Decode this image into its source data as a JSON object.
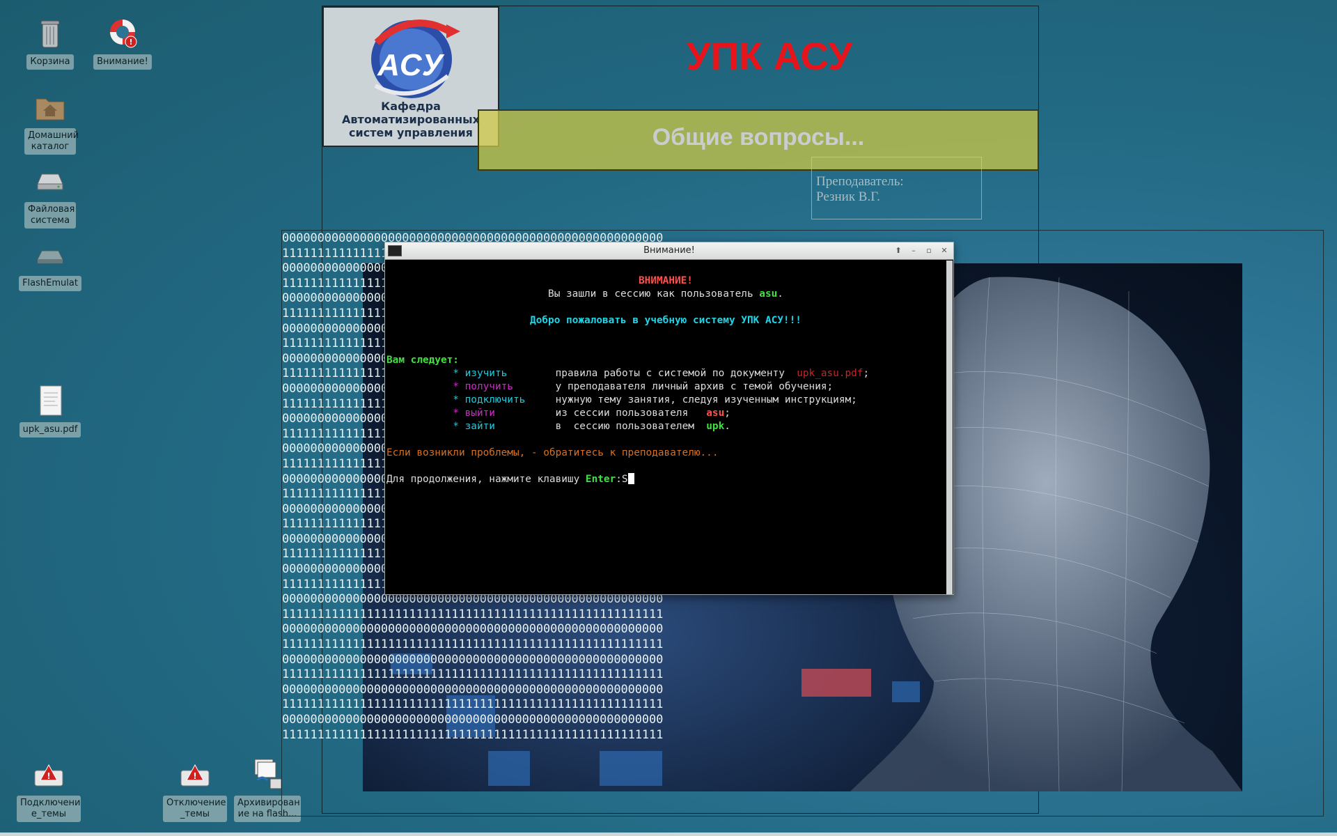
{
  "desktop": {
    "icons": [
      {
        "id": "trash",
        "label": "Корзина"
      },
      {
        "id": "attention",
        "label": "Внимание!"
      },
      {
        "id": "home",
        "label": "Домашний каталог"
      },
      {
        "id": "filesystem",
        "label": "Файловая система"
      },
      {
        "id": "flash",
        "label": "FlashEmulat"
      },
      {
        "id": "pdf",
        "label": "upk_asu.pdf"
      },
      {
        "id": "connect",
        "label": "Подключени е_темы"
      },
      {
        "id": "disconnect",
        "label": "Отключение _темы"
      },
      {
        "id": "archive",
        "label": "Архивирован ие на flash..."
      }
    ]
  },
  "header": {
    "logo_text": "АСУ",
    "dept_line1": "Кафедра",
    "dept_line2": "Автоматизированных",
    "dept_line3": "систем управления",
    "title": "УПК АСУ",
    "subtitle": "Общие вопросы...",
    "teacher_label": "Преподаватель:",
    "teacher_name": "Резник В.Г."
  },
  "terminal": {
    "title": "Внимание!",
    "warning": "ВНИМАНИЕ!",
    "session_prefix": "Вы зашли в сессию как пользователь ",
    "session_user": "asu",
    "welcome": "Добро пожаловать в учебную систему УПК АСУ!!!",
    "should": "Вам следует:",
    "steps": [
      {
        "verb": "изучить",
        "text": "правила работы с системой по документу  ",
        "extra": "upk_asu.pdf",
        "tail": ";"
      },
      {
        "verb": "получить",
        "text": "у преподавателя личный архив с темой обучения;",
        "extra": "",
        "tail": ""
      },
      {
        "verb": "подключить",
        "text": "нужную тему занятия, следуя изученным инструкциям;",
        "extra": "",
        "tail": ""
      },
      {
        "verb": "выйти",
        "text": "из сессии пользователя   ",
        "extra": "asu",
        "tail": ";"
      },
      {
        "verb": "зайти",
        "text": "в  сессию пользователем  ",
        "extra": "upk",
        "tail": "."
      }
    ],
    "problems": "Если возникли проблемы, - обратитесь к преподавателю...",
    "continue_prefix": "Для продолжения, нажмите клавишу ",
    "continue_key": "Enter",
    "continue_input": "S"
  }
}
